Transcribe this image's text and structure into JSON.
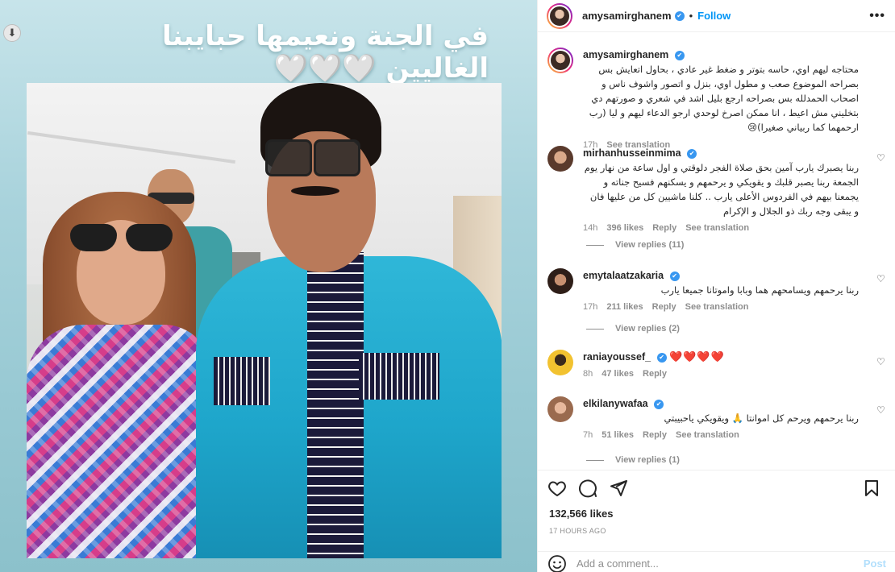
{
  "post": {
    "banner_text": "في الجنة ونعيمها حبايبنا الغاليين 🤍🤍🤍"
  },
  "header": {
    "username": "amysamirghanem",
    "separator": "•",
    "follow_label": "Follow",
    "more_label": "•••"
  },
  "caption": {
    "username": "amysamirghanem",
    "text": "محتاجه ليهم اوي، حاسه بتوتر و ضغط غير عادي ، بحاول اتعايش بس بصراحه الموضوع صعب و مطول اوي، بنزل و اتصور واشوف ناس و اصحاب الحمدلله بس بصراحه ارجع بليل اشد في شعري و صورتهم دي بتخليني مش اعيط ، انا ممكن اصرخ لوحدي ارجو الدعاء ليهم و ليا (رب ارحمهما كما ربياني صغيرا)😢",
    "time": "17h",
    "see_translation": "See translation"
  },
  "comments": [
    {
      "username": "mirhanhusseinmima",
      "text": "ربنا يصبرك يارب آمين بحق صلاة الفجر دلوقتي و اول ساعة من نهار يوم الجمعة ربنا يصبر قلبك و يقويكي و يرحمهم و يسكنهم فسيح جناته و يجمعنا بيهم في الفردوس الأعلى يارب .. كلنا ماشيين كل من عليها فان و يبقى وجه ربك ذو الجلال و الإكرام",
      "time": "14h",
      "likes": "396 likes",
      "reply": "Reply",
      "see_translation": "See translation",
      "view_replies": "View replies (11)"
    },
    {
      "username": "emytalaatzakaria",
      "text": "ربنا يرحمهم ويسامحهم هما وبابا واموتانا جميعا يارب",
      "time": "17h",
      "likes": "211 likes",
      "reply": "Reply",
      "see_translation": "See translation",
      "view_replies": "View replies (2)"
    },
    {
      "username": "raniayoussef_",
      "text": "❤️❤️❤️❤️",
      "time": "8h",
      "likes": "47 likes",
      "reply": "Reply"
    },
    {
      "username": "elkilanywafaa",
      "text": "ربنا يرحمهم ويرحم كل اموانتا 🙏 ويقويكي ياحبيبتي",
      "time": "7h",
      "likes": "51 likes",
      "reply": "Reply",
      "see_translation": "See translation",
      "view_replies": "View replies (1)"
    }
  ],
  "footer": {
    "likes": "132,566 likes",
    "timestamp": "17 HOURS AGO",
    "comment_placeholder": "Add a comment...",
    "post_label": "Post"
  },
  "colors": {
    "link_blue": "#0095f6",
    "verified_blue": "#3897f0",
    "heart_red": "#ed4956",
    "muted": "#8e8e8e"
  }
}
